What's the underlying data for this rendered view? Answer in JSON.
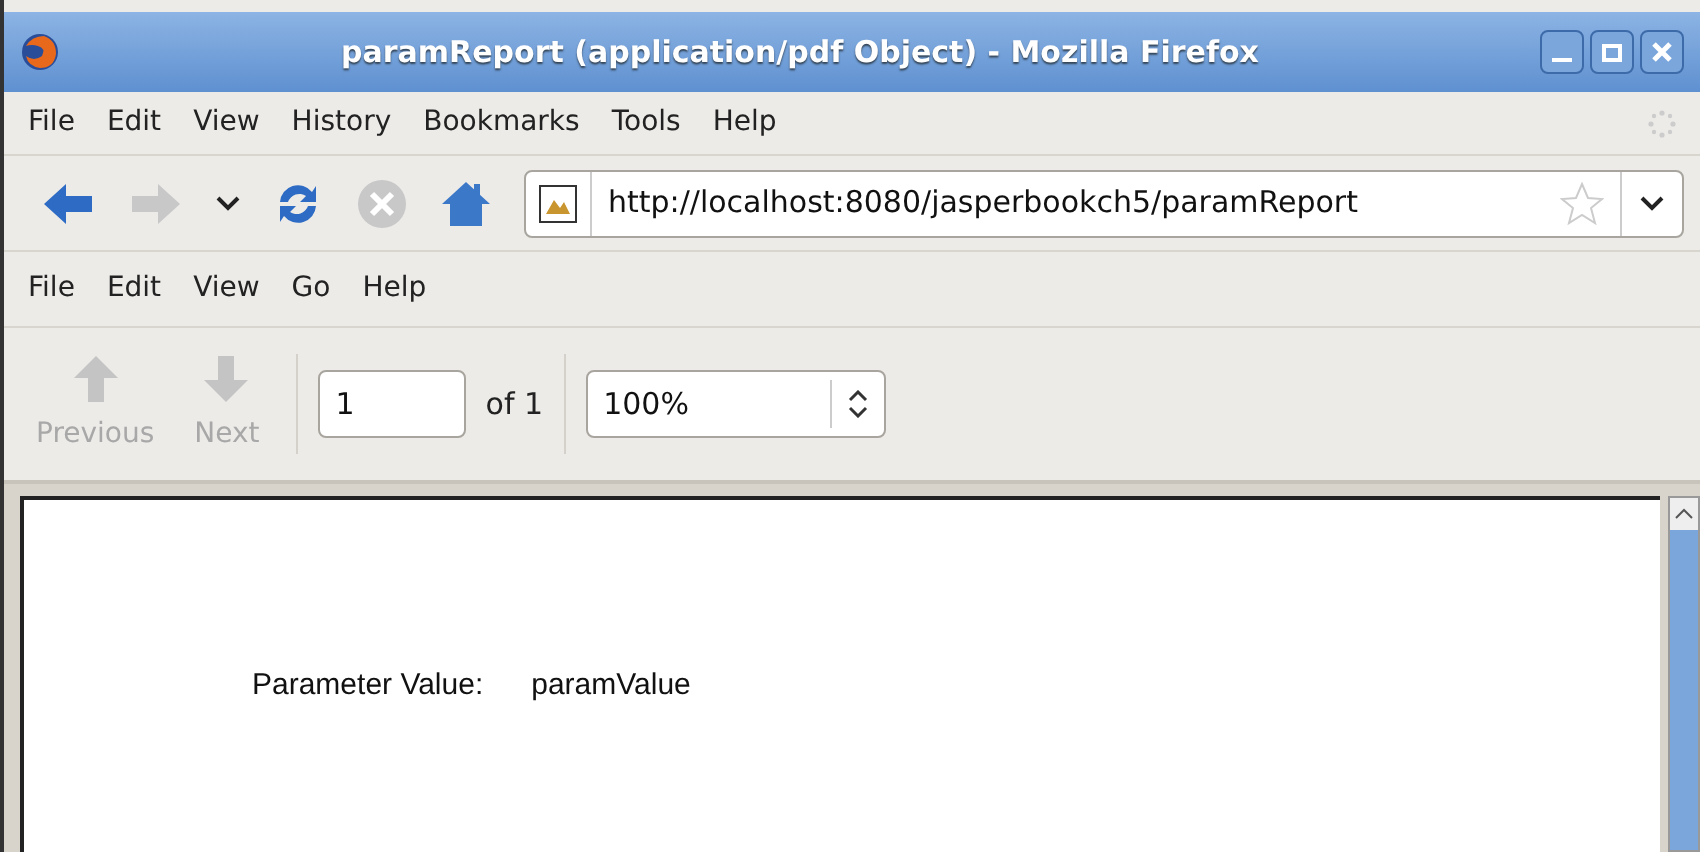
{
  "window": {
    "title": "paramReport (application/pdf Object) - Mozilla Firefox"
  },
  "menu_bar": [
    {
      "label": "File"
    },
    {
      "label": "Edit"
    },
    {
      "label": "View"
    },
    {
      "label": "History"
    },
    {
      "label": "Bookmarks"
    },
    {
      "label": "Tools"
    },
    {
      "label": "Help"
    }
  ],
  "navigation": {
    "back": {
      "disabled": false
    },
    "forward": {
      "disabled": true
    },
    "stop": {
      "disabled": true
    },
    "url": "http://localhost:8080/jasperbookch5/paramReport"
  },
  "viewer_menu": [
    {
      "label": "File"
    },
    {
      "label": "Edit"
    },
    {
      "label": "View"
    },
    {
      "label": "Go"
    },
    {
      "label": "Help"
    }
  ],
  "viewer_toolbar": {
    "buttons": [
      {
        "label": "Previous",
        "kind": "up",
        "disabled": true
      },
      {
        "label": "Next",
        "kind": "down",
        "disabled": true
      }
    ],
    "page": "1",
    "page_count": "of 1",
    "zoom": "100%"
  },
  "document": {
    "label": "Parameter Value:",
    "value": "paramValue"
  }
}
